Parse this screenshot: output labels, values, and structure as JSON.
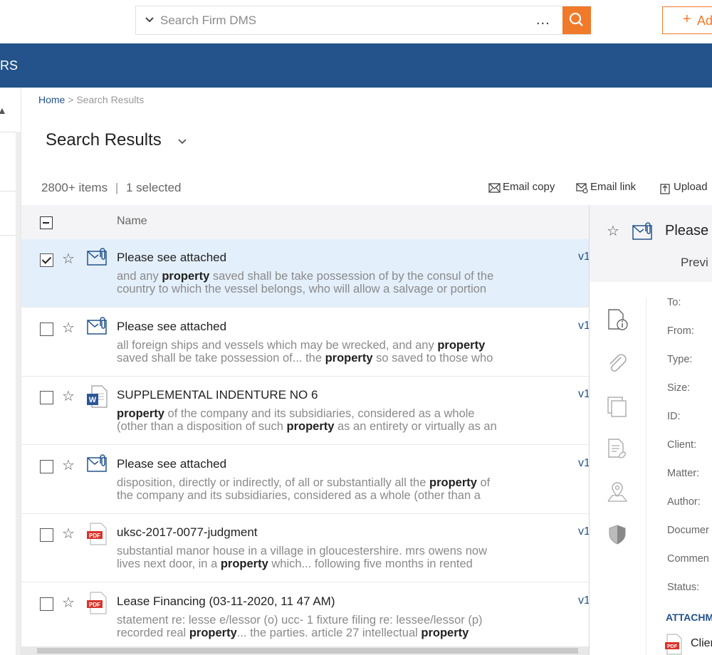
{
  "search": {
    "placeholder": "Search Firm DMS",
    "more_label": "...",
    "submit_icon": "search-icon",
    "accent": "#f07a2a"
  },
  "add_button": {
    "plus": "+",
    "label": "Ad"
  },
  "navbar": {
    "text": "RS",
    "color": "#23538a"
  },
  "breadcrumb": {
    "home": "Home",
    "separator": ">",
    "current": "Search Results"
  },
  "page": {
    "title": "Search Results"
  },
  "summary": {
    "count": "2800+ items",
    "divider": "|",
    "selected": "1 selected"
  },
  "actions": [
    {
      "label": "Email copy",
      "icon": "email-copy-icon"
    },
    {
      "label": "Email link",
      "icon": "email-link-icon"
    },
    {
      "label": "Upload",
      "icon": "upload-icon"
    }
  ],
  "list": {
    "header_name": "Name",
    "rows": [
      {
        "type": "email",
        "title": "Please see attached",
        "selected": true,
        "version": "v1",
        "line1": [
          "and any ",
          "property",
          " saved shall be take possession of by the consul of the"
        ],
        "line2": [
          "country to which the vessel belongs, who will allow a salvage or portion",
          "",
          ""
        ]
      },
      {
        "type": "email",
        "title": "Please see attached",
        "selected": false,
        "version": "v1",
        "line1": [
          "all foreign ships and vessels which may be wrecked, and any ",
          "property",
          ""
        ],
        "line2": [
          "saved shall be take possession of... the ",
          "property",
          " so saved to those who"
        ]
      },
      {
        "type": "word",
        "title": "SUPPLEMENTAL INDENTURE NO 6",
        "selected": false,
        "version": "v1",
        "line1": [
          "",
          "property",
          " of the company and its subsidiaries, considered as a whole"
        ],
        "line2": [
          "(other than a disposition of such ",
          "property",
          " as an entirety or virtually as an"
        ]
      },
      {
        "type": "email",
        "title": "Please see attached",
        "selected": false,
        "version": "v1",
        "line1": [
          "disposition, directly or indirectly, of all or substantially all the ",
          "property",
          " of"
        ],
        "line2": [
          "the company and its subsidiaries, considered as a whole (other than a",
          "",
          ""
        ]
      },
      {
        "type": "pdf",
        "title": "uksc-2017-0077-judgment",
        "selected": false,
        "version": "v1",
        "line1": [
          "substantial manor house in a village in gloucestershire. mrs owens now",
          "",
          ""
        ],
        "line2": [
          "lives next door, in a ",
          "property",
          " which... following five months in rented"
        ]
      },
      {
        "type": "pdf",
        "title": "Lease Financing (03-11-2020, 11 47 AM)",
        "selected": false,
        "version": "v1",
        "line1": [
          "statement re: lesse e/lessor (o) ucc- 1 fixture filing re: lessee/lessor (p)",
          "",
          ""
        ],
        "line2": [
          "recorded real ",
          "property",
          "... the parties. article 27 intellectual ",
          "property"
        ]
      }
    ]
  },
  "preview": {
    "title": "Please",
    "tab": "Previ",
    "tools": [
      "document-info-icon",
      "paperclip-icon",
      "copies-icon",
      "linked-document-icon",
      "location-pin-icon",
      "shield-icon"
    ],
    "fields": [
      "To:",
      "From:",
      "Type:",
      "Size:",
      "ID:",
      "Client:",
      "Matter:",
      "Author:",
      "Documer",
      "Commen",
      "Status:"
    ],
    "attachments_header": "ATTACHM",
    "attachment_label": "Clier",
    "pdf_badge": "PDF"
  }
}
